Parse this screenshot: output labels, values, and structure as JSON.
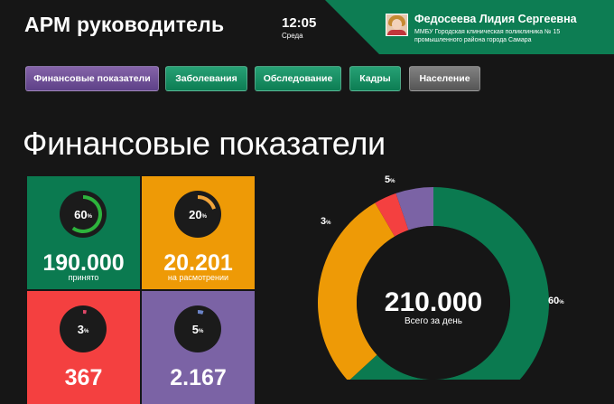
{
  "header": {
    "title": "АРМ руководитель",
    "time": "12:05",
    "day": "Среда",
    "user_name": "Федосеева Лидия Сергеевна",
    "organization": "ММБУ Городская клиническая поликлиника № 15 промышленного района города Самара",
    "panel_color": "#0d7d53"
  },
  "tabs": [
    {
      "label": "Финансовые показатели",
      "active": true
    },
    {
      "label": "Заболевания"
    },
    {
      "label": "Обследование"
    },
    {
      "label": "Кадры"
    },
    {
      "label": "Население"
    }
  ],
  "page_title": "Финансовые показатели",
  "tiles": [
    {
      "value": "190.000",
      "caption": "принято",
      "percent": 60,
      "color": "#0b7a50",
      "accent": "#2db43c"
    },
    {
      "value": "20.201",
      "caption": "на расмотрении",
      "percent": 20,
      "color": "#ee9a06",
      "accent": "#f1a53a"
    },
    {
      "value": "367",
      "caption": "",
      "percent": 3,
      "color": "#f44040",
      "accent": "#e04868"
    },
    {
      "value": "2.167",
      "caption": "",
      "percent": 5,
      "color": "#7b63a5",
      "accent": "#6b84c8"
    }
  ],
  "donut": {
    "total": "210.000",
    "total_caption": "Всего за день",
    "segments": [
      {
        "percent": 60,
        "label": "60",
        "color": "#0b7a50"
      },
      {
        "percent": 27,
        "label": "",
        "color": "#ee9a06"
      },
      {
        "percent": 3,
        "label": "3",
        "color": "#f44040"
      },
      {
        "percent": 5,
        "label": "5",
        "color": "#7b63a5"
      }
    ],
    "percent_sign": "%"
  }
}
